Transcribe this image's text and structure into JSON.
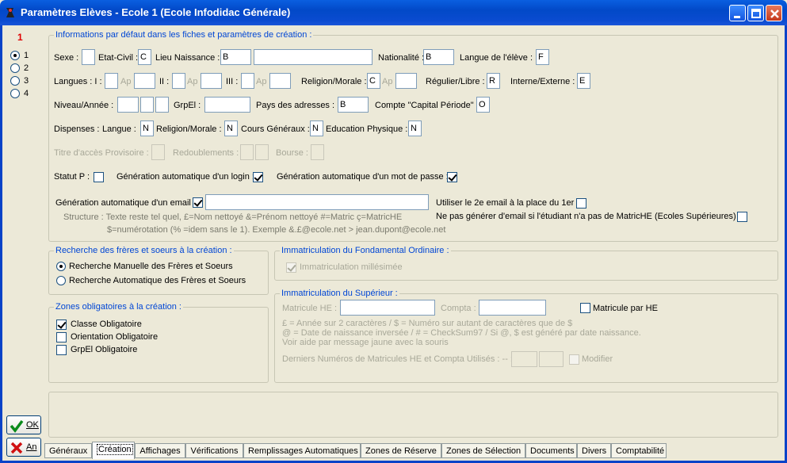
{
  "window": {
    "title": "Paramètres Elèves - Ecole 1 (Ecole Infodidac Générale)"
  },
  "side": {
    "number": "1",
    "radios": [
      "1",
      "2",
      "3",
      "4"
    ],
    "ok": "OK",
    "cancel": "An"
  },
  "info": {
    "legend": "Informations par défaut dans les fiches et paramètres de création :",
    "sexe": "Sexe :",
    "etat_civil": "Etat-Civil :",
    "etat_civil_val": "C",
    "lieu_naissance": "Lieu Naissance :",
    "lieu_val": "B",
    "nationalite": "Nationalité :",
    "nationalite_val": "B",
    "langue_eleve": "Langue de l'élève :",
    "langue_eleve_val": "F",
    "langues": "Langues : I :",
    "ap": "Ap",
    "ii": "II :",
    "iii": "III :",
    "religion": "Religion/Morale :",
    "religion_val": "C",
    "regulier": "Régulier/Libre :",
    "regulier_val": "R",
    "interne": "Interne/Externe :",
    "interne_val": "E",
    "niveau": "Niveau/Année :",
    "grpel": "GrpEl :",
    "pays": "Pays des adresses :",
    "pays_val": "B",
    "compte": "Compte \"Capital Période\" :",
    "compte_val": "O",
    "dispenses": "Dispenses :",
    "langue": "Langue :",
    "langue_val": "N",
    "rel_morale": "Religion/Morale :",
    "rel_morale_val": "N",
    "cours_gen": "Cours Généraux :",
    "cours_gen_val": "N",
    "educ_phys": "Education Physique :",
    "educ_phys_val": "N",
    "titre_acces": "Titre d'accès Provisoire :",
    "redoublements": "Redoublements :",
    "bourse": "Bourse :",
    "statut_p": "Statut P :",
    "gen_login": "Génération automatique d'un login :",
    "gen_mdp": "Génération automatique d'un mot de passe :",
    "gen_email": "Génération automatique d'un email :",
    "use_2e_email": "Utiliser le 2e email à la place du 1er :",
    "no_email": "Ne pas générer d'email si l'étudiant n'a pas de MatricHE (Ecoles Supérieures) :",
    "structure1": "Structure : Texte reste tel quel, £=Nom nettoyé &=Prénom nettoyé  #=Matric  ç=MatricHE",
    "structure2": "$=numérotation (% =idem sans le 1).  Exemple &.£@ecole.net > jean.dupont@ecole.net"
  },
  "freres": {
    "legend": "Recherche des frères et soeurs à la création :",
    "manual": "Recherche Manuelle des Frères et Soeurs",
    "auto": "Recherche Automatique des Frères et Soeurs"
  },
  "zones": {
    "legend": "Zones obligatoires à la création :",
    "classe": "Classe Obligatoire",
    "orientation": "Orientation Obligatoire",
    "grpel": "GrpEl Obligatoire"
  },
  "fond": {
    "legend": "Immatriculation du Fondamental Ordinaire :",
    "millesime": "Immatriculation millésimée"
  },
  "sup": {
    "legend": "Immatriculation du Supérieur :",
    "matricule_he": "Matricule HE :",
    "compta": "Compta :",
    "matricule_par_he": "Matricule par HE",
    "help1": "£ = Année sur 2 caractères / $ = Numéro sur autant de caractères que de $",
    "help2": "@ = Date de naissance inversée / # = CheckSum97 / Si @, $ est généré par date naissance.",
    "help3": "Voir aide par message jaune avec la souris",
    "derniers": "Derniers Numéros de Matricules HE et Compta Utilisés : --  :",
    "modifier": "Modifier"
  },
  "tabs": [
    "Généraux",
    "Création",
    "Affichages",
    "Vérifications",
    "Remplissages Automatiques",
    "Zones de Réserve",
    "Zones de Sélection",
    "Documents",
    "Divers",
    "Comptabilité"
  ],
  "colors": {
    "title_blue": "#0249c8",
    "legend_blue": "#0046d5",
    "bg": "#ece9d8"
  }
}
